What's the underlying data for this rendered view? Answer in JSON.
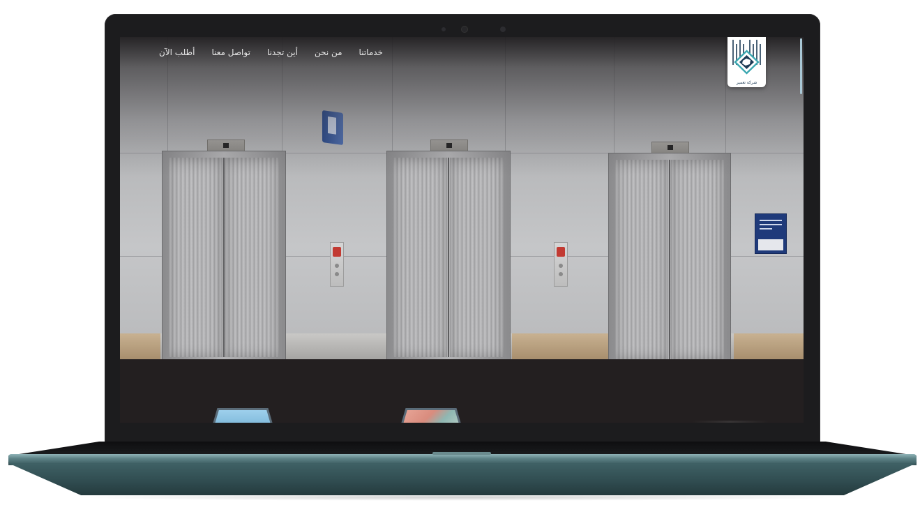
{
  "nav": {
    "items": [
      {
        "label": "خدماتنا"
      },
      {
        "label": "من نحن"
      },
      {
        "label": "أين تجدنا"
      },
      {
        "label": "تواصل معنا"
      },
      {
        "label": "أطلب الآن"
      }
    ]
  },
  "logo": {
    "text": "شركة تعمير"
  },
  "colors": {
    "page_bg": "#231f20",
    "nav_text": "#e8e8e8",
    "logo_accent": "#1d3b55",
    "logo_teal": "#3aa7b0",
    "scrollbar": "#a9c8d6",
    "laptop_base": "#3f6165"
  },
  "hero": {
    "image": "elevators-photo"
  }
}
